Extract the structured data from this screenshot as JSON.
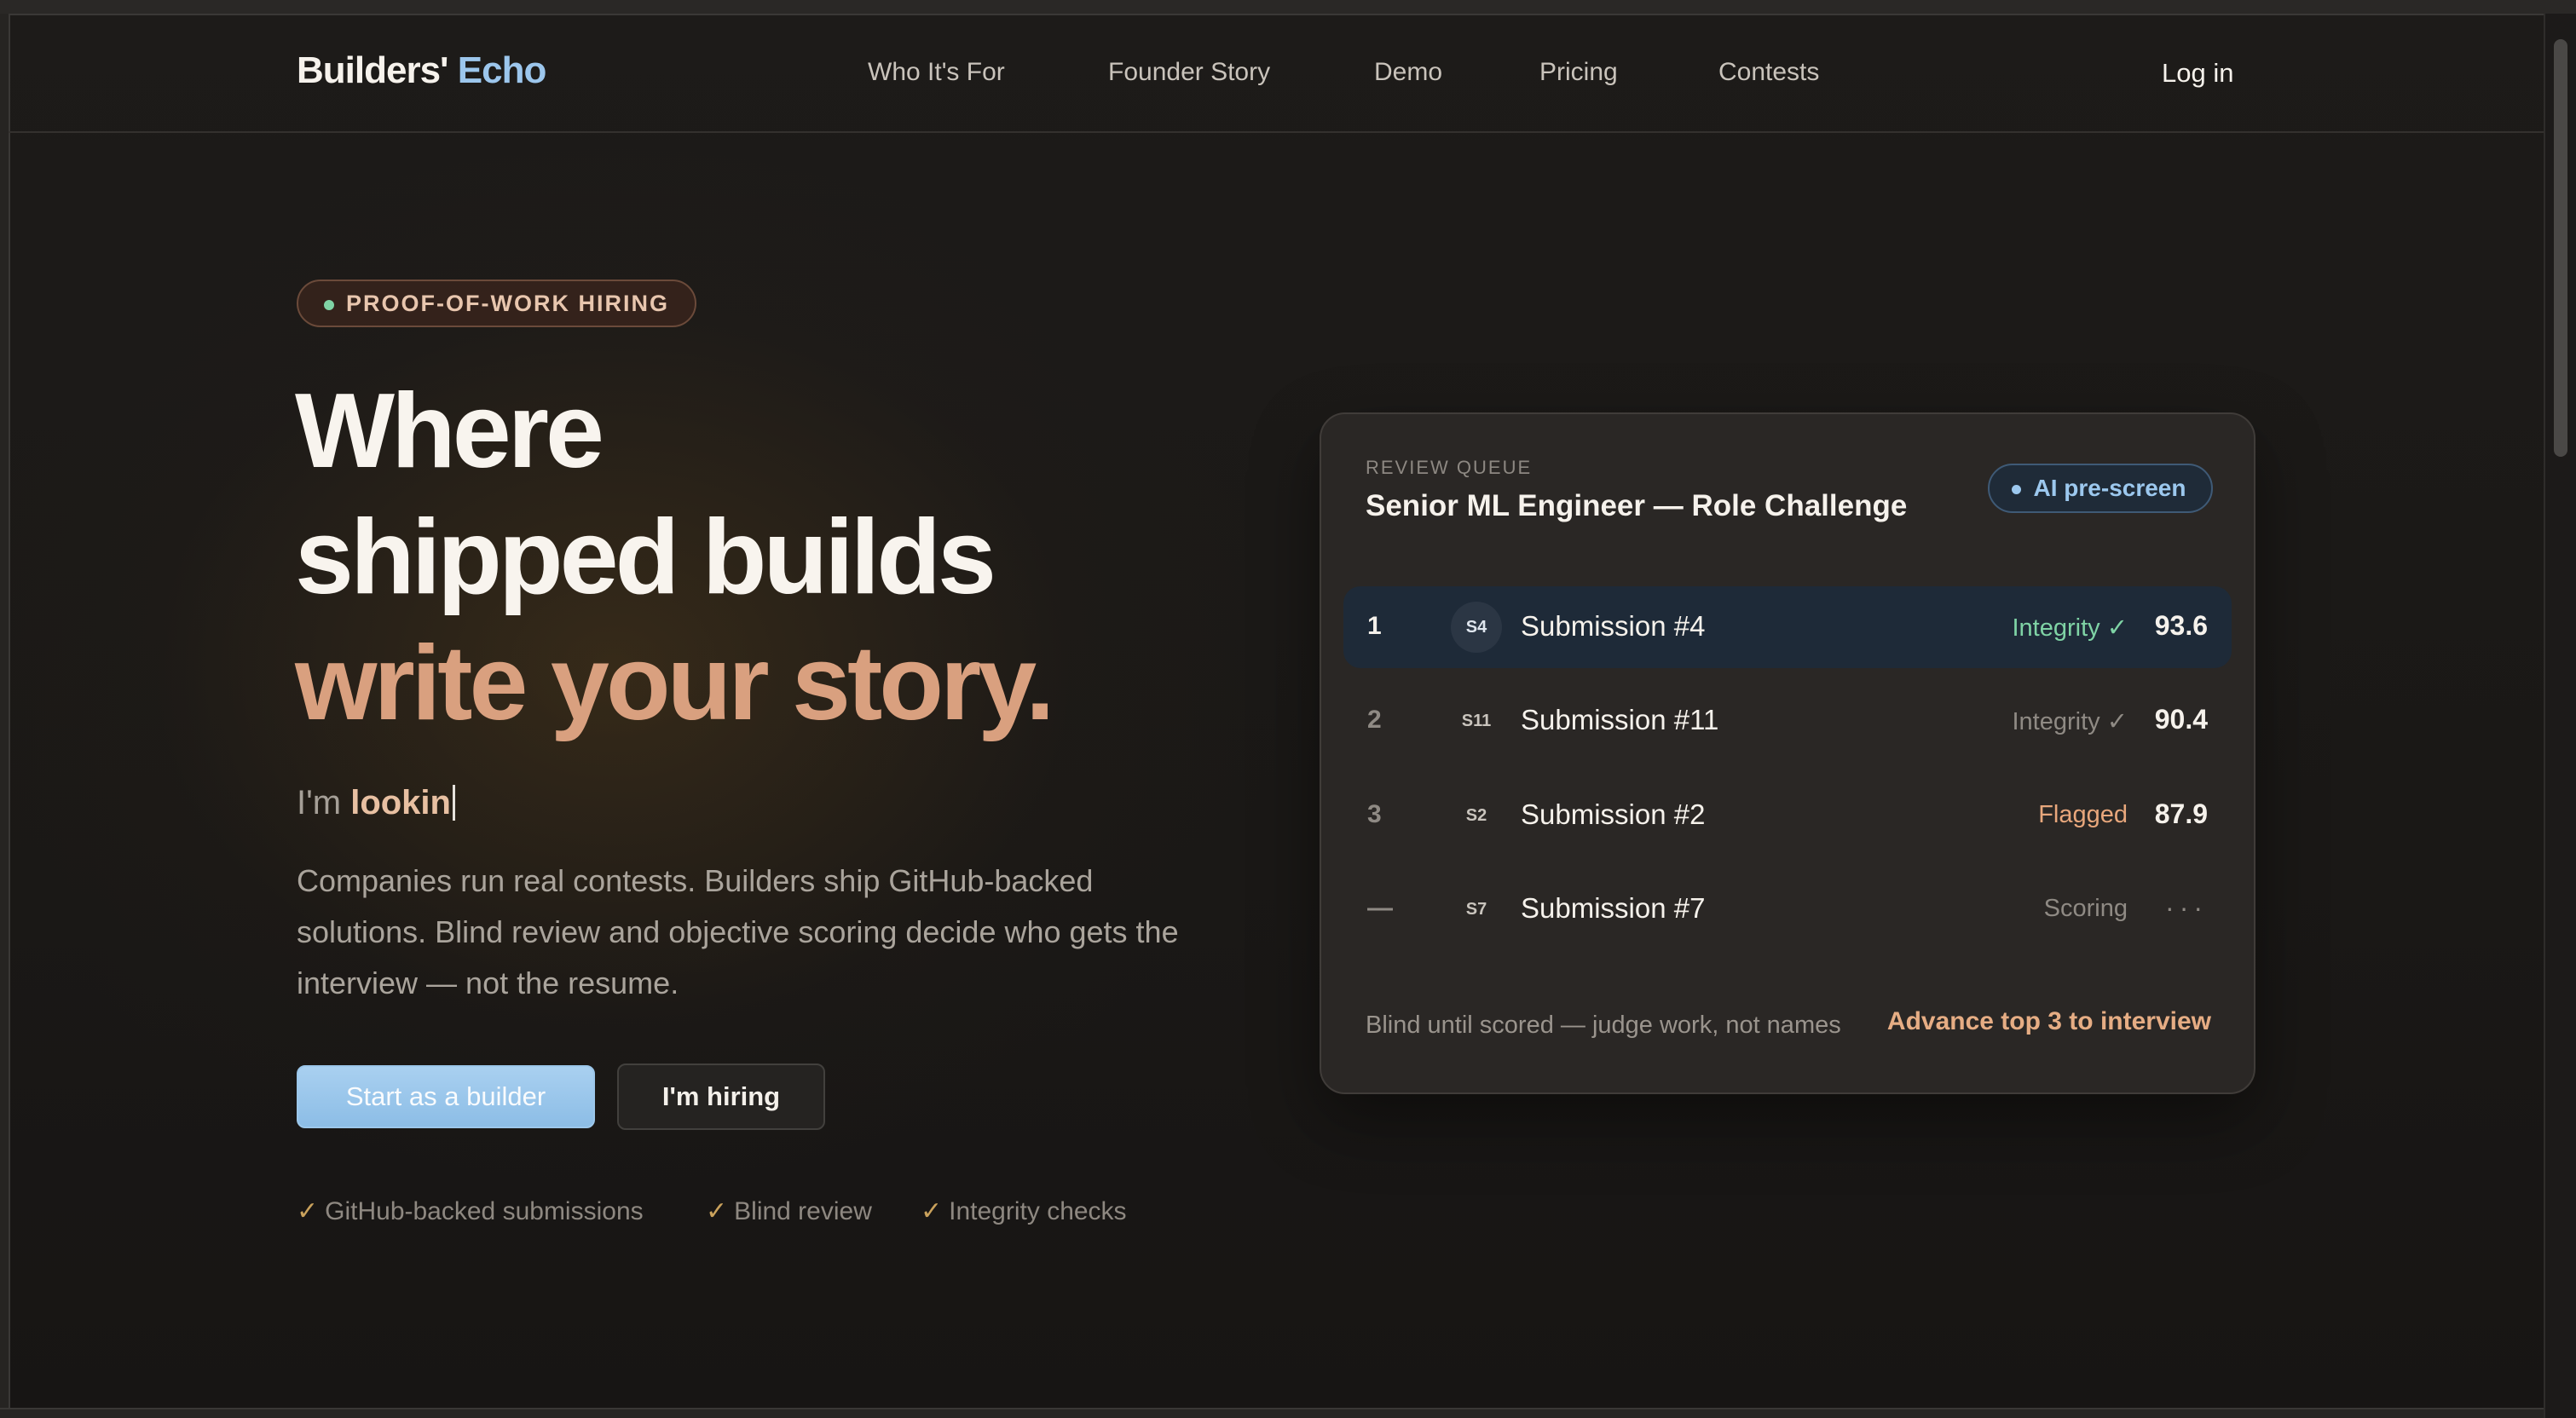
{
  "brand": {
    "part1": "Builders'",
    "part2": "Echo"
  },
  "nav": {
    "links": [
      "Who It's For",
      "Founder Story",
      "Demo",
      "Pricing",
      "Contests"
    ],
    "login": "Log in"
  },
  "hero": {
    "badge": "PROOF-OF-WORK HIRING",
    "headline": [
      "Where",
      "shipped builds",
      "write your story."
    ],
    "typing_prefix": "I'm",
    "typing_value": "lookin",
    "description": "Companies run real contests. Builders ship GitHub-backed solutions. Blind review and objective scoring decide who gets the interview — not the resume.",
    "primary_cta": "Start as a builder",
    "secondary_cta": "I'm hiring",
    "checks": [
      "GitHub-backed submissions",
      "Blind review",
      "Integrity checks"
    ],
    "check_glyph": "✓"
  },
  "review_card": {
    "eyebrow": "REVIEW QUEUE",
    "title": "Senior ML Engineer — Role Challenge",
    "pill": "AI pre-screen",
    "rows": [
      {
        "rank": "1",
        "avatar": "S4",
        "name": "Submission #4",
        "status": "Integrity ✓",
        "score": "93.6"
      },
      {
        "rank": "2",
        "avatar": "S11",
        "name": "Submission #11",
        "status": "Integrity ✓",
        "score": "90.4"
      },
      {
        "rank": "3",
        "avatar": "S2",
        "name": "Submission #2",
        "status": "Flagged",
        "score": "87.9"
      },
      {
        "rank": "—",
        "avatar": "S7",
        "name": "Submission #7",
        "status": "Scoring",
        "score": "···"
      }
    ],
    "footer_note": "Blind until scored — judge work, not names",
    "footer_cta": "Advance top 3 to interview"
  },
  "colors": {
    "accent_blue": "#9cc6ec",
    "accent_peach": "#d9a07f",
    "status_green": "#7fd3a5",
    "status_orange": "#e8a77c",
    "background": "#1a1816"
  }
}
